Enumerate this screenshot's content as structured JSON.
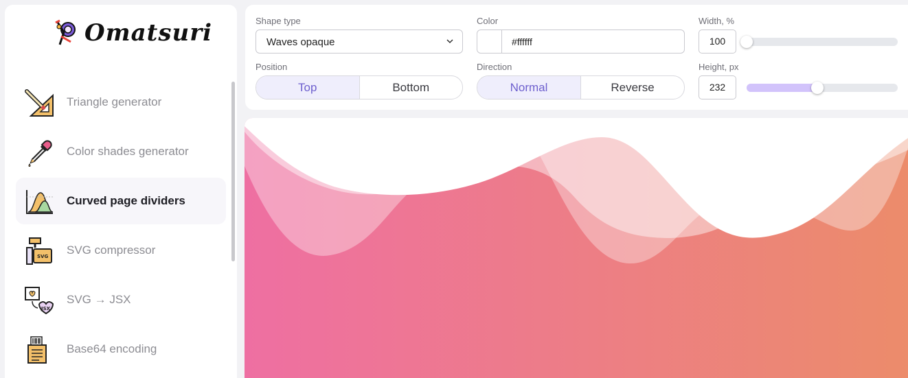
{
  "sidebar": {
    "logo_text": "Omatsuri",
    "items": [
      {
        "label": "Triangle generator",
        "icon": "triangle-ruler-icon",
        "active": false
      },
      {
        "label": "Color shades generator",
        "icon": "pipette-icon",
        "active": false
      },
      {
        "label": "Curved page dividers",
        "icon": "curve-chart-icon",
        "active": true
      },
      {
        "label": "SVG compressor",
        "icon": "svg-press-icon",
        "active": false
      },
      {
        "label": "SVG → JSX",
        "icon": "svg-to-jsx-icon",
        "active": false
      },
      {
        "label": "Base64 encoding",
        "icon": "barcode-document-icon",
        "active": false
      }
    ]
  },
  "controls": {
    "shape_type": {
      "label": "Shape type",
      "value": "Waves opaque"
    },
    "color": {
      "label": "Color",
      "value": "#ffffff"
    },
    "width": {
      "label": "Width, %",
      "value": "100",
      "fraction": 0.0
    },
    "position": {
      "label": "Position",
      "options": [
        "Top",
        "Bottom"
      ],
      "selected": "Top"
    },
    "direction": {
      "label": "Direction",
      "options": [
        "Normal",
        "Reverse"
      ],
      "selected": "Normal"
    },
    "height": {
      "label": "Height, px",
      "value": "232",
      "fraction": 0.47
    }
  },
  "colors": {
    "accent": "#6d5fce",
    "accent_light": "#efeefc",
    "slider_fill": "#d2c3fb",
    "gradient_start": "#ee6fa2",
    "gradient_end": "#ec8c6a",
    "divider": "#ffffff"
  }
}
